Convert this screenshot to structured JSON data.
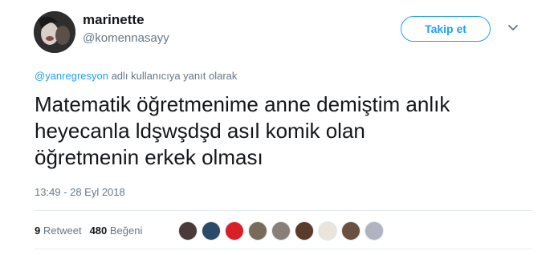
{
  "user": {
    "display_name": "marinette",
    "handle": "@komennasayy"
  },
  "follow_button": {
    "label": "Takip et",
    "color": "#1da1f2"
  },
  "reply": {
    "mention": "@yanregresyon",
    "suffix": " adlı kullanıcıya yanıt olarak"
  },
  "tweet": {
    "lines": [
      "Matematik öğretmenime anne demiştim anlık",
      "heyecanla ldşwşdşd asıl komik olan",
      "öğretmenin erkek olması"
    ]
  },
  "timestamp": "13:49 - 28 Eyl 2018",
  "stats": {
    "retweet_count": "9",
    "retweet_label": "Retweet",
    "like_count": "480",
    "like_label": "Beğeni"
  },
  "likers": [
    {
      "name": "liker-avatar-1",
      "color": "#4a3a3a"
    },
    {
      "name": "liker-avatar-2",
      "color": "#2b4a6a"
    },
    {
      "name": "liker-avatar-3",
      "color": "#d91f26"
    },
    {
      "name": "liker-avatar-4",
      "color": "#7a6a5a"
    },
    {
      "name": "liker-avatar-5",
      "color": "#8a7f78"
    },
    {
      "name": "liker-avatar-6",
      "color": "#5a3a2a"
    },
    {
      "name": "liker-avatar-7",
      "color": "#e9e4dc"
    },
    {
      "name": "liker-avatar-8",
      "color": "#6a5040"
    },
    {
      "name": "liker-avatar-9",
      "color": "#b0b4c0"
    }
  ]
}
